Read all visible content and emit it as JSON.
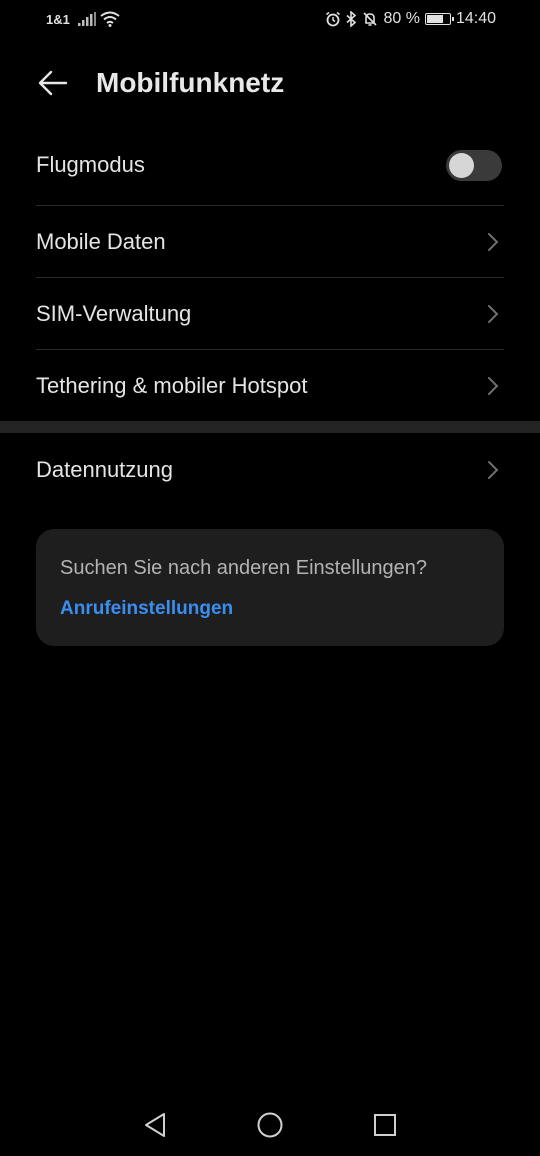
{
  "status_bar": {
    "carrier": "1&1",
    "battery_text": "80 %",
    "battery_level": 0.8,
    "time": "14:40",
    "icons": [
      "signal-icon",
      "wifi-icon",
      "alarm-icon",
      "bluetooth-icon",
      "mute-icon",
      "battery-icon"
    ]
  },
  "header": {
    "title": "Mobilfunknetz",
    "back_icon": "arrow-left-icon"
  },
  "settings": {
    "airplane": {
      "label": "Flugmodus",
      "enabled": false
    },
    "mobile_data": {
      "label": "Mobile Daten"
    },
    "sim": {
      "label": "SIM-Verwaltung"
    },
    "tethering": {
      "label": "Tethering & mobiler Hotspot"
    },
    "data_usage": {
      "label": "Datennutzung"
    }
  },
  "suggestion_card": {
    "question": "Suchen Sie nach anderen Einstellungen?",
    "link": "Anrufeinstellungen",
    "link_color": "#3b8ef0"
  },
  "navbar": {
    "icons": [
      "nav-back-icon",
      "nav-home-icon",
      "nav-recents-icon"
    ]
  },
  "colors": {
    "background": "#000000",
    "divider": "#2b2b2b",
    "card": "#1e1e1e"
  }
}
